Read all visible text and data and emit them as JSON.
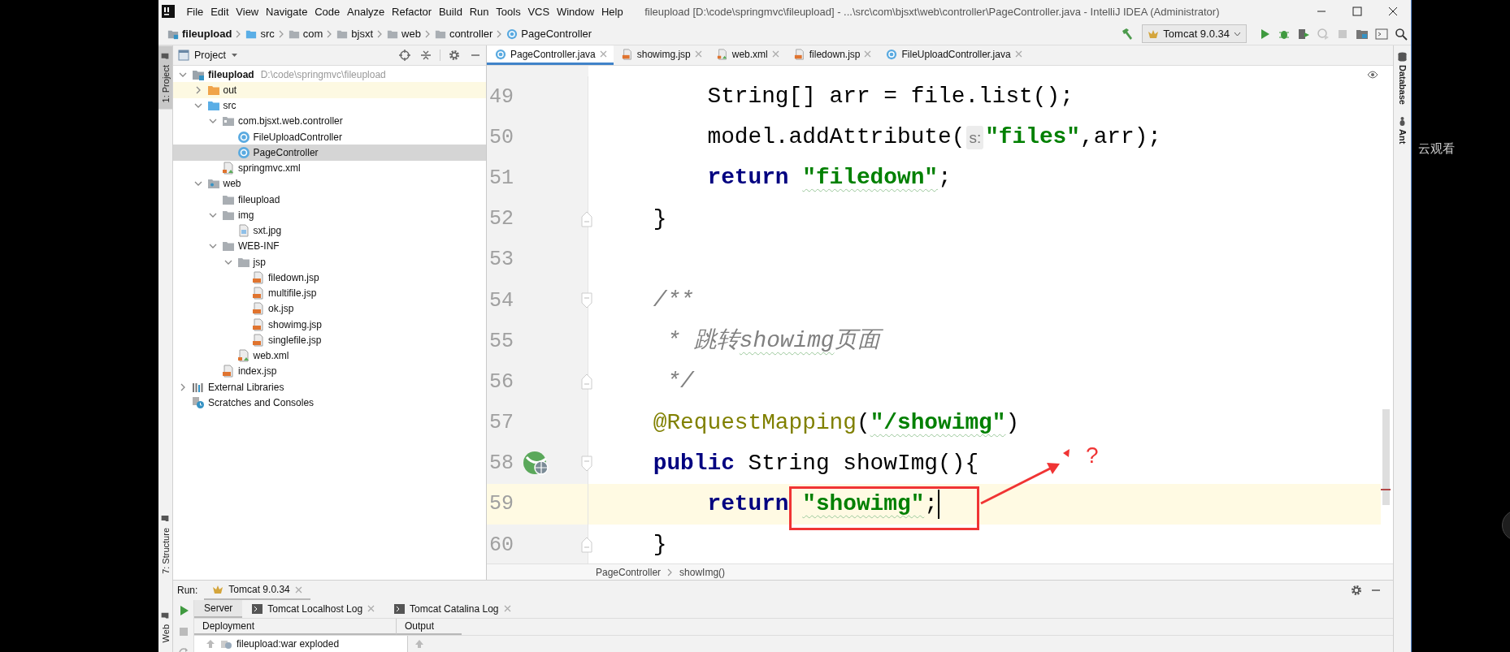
{
  "window": {
    "title": "fileupload [D:\\code\\springmvc\\fileupload] - ...\\src\\com\\bjsxt\\web\\controller\\PageController.java - IntelliJ IDEA (Administrator)"
  },
  "menu": [
    "File",
    "Edit",
    "View",
    "Navigate",
    "Code",
    "Analyze",
    "Refactor",
    "Build",
    "Run",
    "Tools",
    "VCS",
    "Window",
    "Help"
  ],
  "navigation": {
    "crumbs": [
      {
        "label": "fileupload",
        "kind": "module"
      },
      {
        "label": "src",
        "kind": "source"
      },
      {
        "label": "com",
        "kind": "folder"
      },
      {
        "label": "bjsxt",
        "kind": "folder"
      },
      {
        "label": "web",
        "kind": "folder"
      },
      {
        "label": "controller",
        "kind": "folder"
      },
      {
        "label": "PageController",
        "kind": "class"
      }
    ],
    "run_config": "Tomcat 9.0.34"
  },
  "left_stripe": [
    {
      "label": "1: Project",
      "kind": "top",
      "selected": true
    },
    {
      "label": "7: Structure",
      "kind": "bottom",
      "selected": false
    },
    {
      "label": "Web",
      "kind": "bottom",
      "selected": false
    }
  ],
  "project": {
    "title": "Project",
    "tree": [
      {
        "label": "fileupload",
        "path": "D:\\code\\springmvc\\fileupload",
        "kind": "module",
        "expanded": true,
        "selected": false,
        "children": [
          {
            "label": "out",
            "kind": "excluded",
            "expanded": false,
            "selected": false
          },
          {
            "label": "src",
            "kind": "source",
            "expanded": true,
            "selected": false,
            "children": [
              {
                "label": "com.bjsxt.web.controller",
                "kind": "package",
                "expanded": true,
                "selected": false,
                "children": [
                  {
                    "label": "FileUploadController",
                    "kind": "class",
                    "selected": false
                  },
                  {
                    "label": "PageController",
                    "kind": "class",
                    "selected": true
                  }
                ]
              },
              {
                "label": "springmvc.xml",
                "kind": "xml",
                "selected": false
              }
            ]
          },
          {
            "label": "web",
            "kind": "web",
            "expanded": true,
            "selected": false,
            "children": [
              {
                "label": "fileupload",
                "kind": "folder",
                "selected": false
              },
              {
                "label": "img",
                "kind": "folder",
                "expanded": true,
                "selected": false,
                "children": [
                  {
                    "label": "sxt.jpg",
                    "kind": "image",
                    "selected": false
                  }
                ]
              },
              {
                "label": "WEB-INF",
                "kind": "folder",
                "expanded": true,
                "selected": false,
                "children": [
                  {
                    "label": "jsp",
                    "kind": "folder",
                    "expanded": true,
                    "selected": false,
                    "children": [
                      {
                        "label": "filedown.jsp",
                        "kind": "jsp",
                        "selected": false
                      },
                      {
                        "label": "multifile.jsp",
                        "kind": "jsp",
                        "selected": false
                      },
                      {
                        "label": "ok.jsp",
                        "kind": "jsp",
                        "selected": false
                      },
                      {
                        "label": "showimg.jsp",
                        "kind": "jsp",
                        "selected": false
                      },
                      {
                        "label": "singlefile.jsp",
                        "kind": "jsp",
                        "selected": false
                      }
                    ]
                  },
                  {
                    "label": "web.xml",
                    "kind": "xml",
                    "selected": false
                  }
                ]
              },
              {
                "label": "index.jsp",
                "kind": "jsp",
                "selected": false
              }
            ]
          }
        ]
      },
      {
        "label": "External Libraries",
        "kind": "library",
        "expanded": false,
        "selected": false
      },
      {
        "label": "Scratches and Consoles",
        "kind": "scratch",
        "selected": false
      }
    ]
  },
  "editor": {
    "tabs": [
      {
        "label": "PageController.java",
        "kind": "class",
        "selected": true
      },
      {
        "label": "showimg.jsp",
        "kind": "jsp",
        "selected": false
      },
      {
        "label": "web.xml",
        "kind": "xml",
        "selected": false
      },
      {
        "label": "filedown.jsp",
        "kind": "jsp",
        "selected": false
      },
      {
        "label": "FileUploadController.java",
        "kind": "class",
        "selected": false
      }
    ],
    "lines": [
      {
        "number": "49",
        "current": false,
        "tokens": [
          {
            "kind": "plain",
            "text": "        String[] arr = file.list();"
          }
        ]
      },
      {
        "number": "50",
        "current": false,
        "tokens": [
          {
            "kind": "plain",
            "text": "        model.addAttribute("
          },
          {
            "kind": "hint",
            "text": "s:"
          },
          {
            "kind": "string",
            "text": "\"files\""
          },
          {
            "kind": "plain",
            "text": ",arr);"
          }
        ]
      },
      {
        "number": "51",
        "current": false,
        "tokens": [
          {
            "kind": "keyword",
            "text": "        return "
          },
          {
            "kind": "string",
            "text": "\"filedown\"",
            "underline": true
          },
          {
            "kind": "plain",
            "text": ";"
          }
        ]
      },
      {
        "number": "52",
        "current": false,
        "markers": [
          {
            "kind": "fold-end"
          }
        ],
        "tokens": [
          {
            "kind": "plain",
            "text": "    }"
          }
        ]
      },
      {
        "number": "53",
        "current": false
      },
      {
        "number": "54",
        "current": false,
        "markers": [
          {
            "kind": "fold-start"
          }
        ],
        "tokens": [
          {
            "kind": "comment",
            "text": "    /**"
          }
        ]
      },
      {
        "number": "55",
        "current": false,
        "tokens": [
          {
            "kind": "comment",
            "text": "     * 跳转"
          },
          {
            "kind": "comment",
            "text": "showimg",
            "underline": true
          },
          {
            "kind": "comment",
            "text": "页面"
          }
        ]
      },
      {
        "number": "56",
        "current": false,
        "markers": [
          {
            "kind": "fold-end"
          }
        ],
        "tokens": [
          {
            "kind": "comment",
            "text": "     */"
          }
        ]
      },
      {
        "number": "57",
        "current": false,
        "tokens": [
          {
            "kind": "annotation",
            "text": "    @RequestMapping"
          },
          {
            "kind": "plain",
            "text": "("
          },
          {
            "kind": "string",
            "text": "\"/showimg\"",
            "underline": true
          },
          {
            "kind": "plain",
            "text": ")"
          }
        ]
      },
      {
        "number": "58",
        "current": false,
        "markers": [
          {
            "kind": "web"
          },
          {
            "kind": "fold-start"
          }
        ],
        "tokens": [
          {
            "kind": "keyword",
            "text": "    public"
          },
          {
            "kind": "plain",
            "text": " String showImg(){"
          }
        ]
      },
      {
        "number": "59",
        "current": true,
        "tokens": [
          {
            "kind": "keyword",
            "text": "        return "
          },
          {
            "kind": "string",
            "text": "\"showimg\"",
            "underline": true
          },
          {
            "kind": "plain",
            "text": ";"
          }
        ]
      },
      {
        "number": "60",
        "current": false,
        "markers": [
          {
            "kind": "fold-end"
          }
        ],
        "tokens": [
          {
            "kind": "plain",
            "text": "    }"
          }
        ]
      }
    ],
    "annotation": "?",
    "breadcrumb": [
      "PageController",
      "showImg()"
    ]
  },
  "right_stripe": [
    {
      "label": "Database",
      "kind": "database"
    },
    {
      "label": "Ant",
      "kind": "ant"
    }
  ],
  "run": {
    "label": "Run:",
    "tab": "Tomcat 9.0.34",
    "subtabs": [
      {
        "label": "Server",
        "kind": "plain",
        "selected": true
      },
      {
        "label": "Tomcat Localhost Log",
        "kind": "log",
        "selected": false
      },
      {
        "label": "Tomcat Catalina Log",
        "kind": "log",
        "selected": false
      }
    ],
    "columns": [
      "Deployment",
      "Output"
    ],
    "deployments": [
      "fileupload:war exploded"
    ]
  },
  "side_text": "云观看"
}
